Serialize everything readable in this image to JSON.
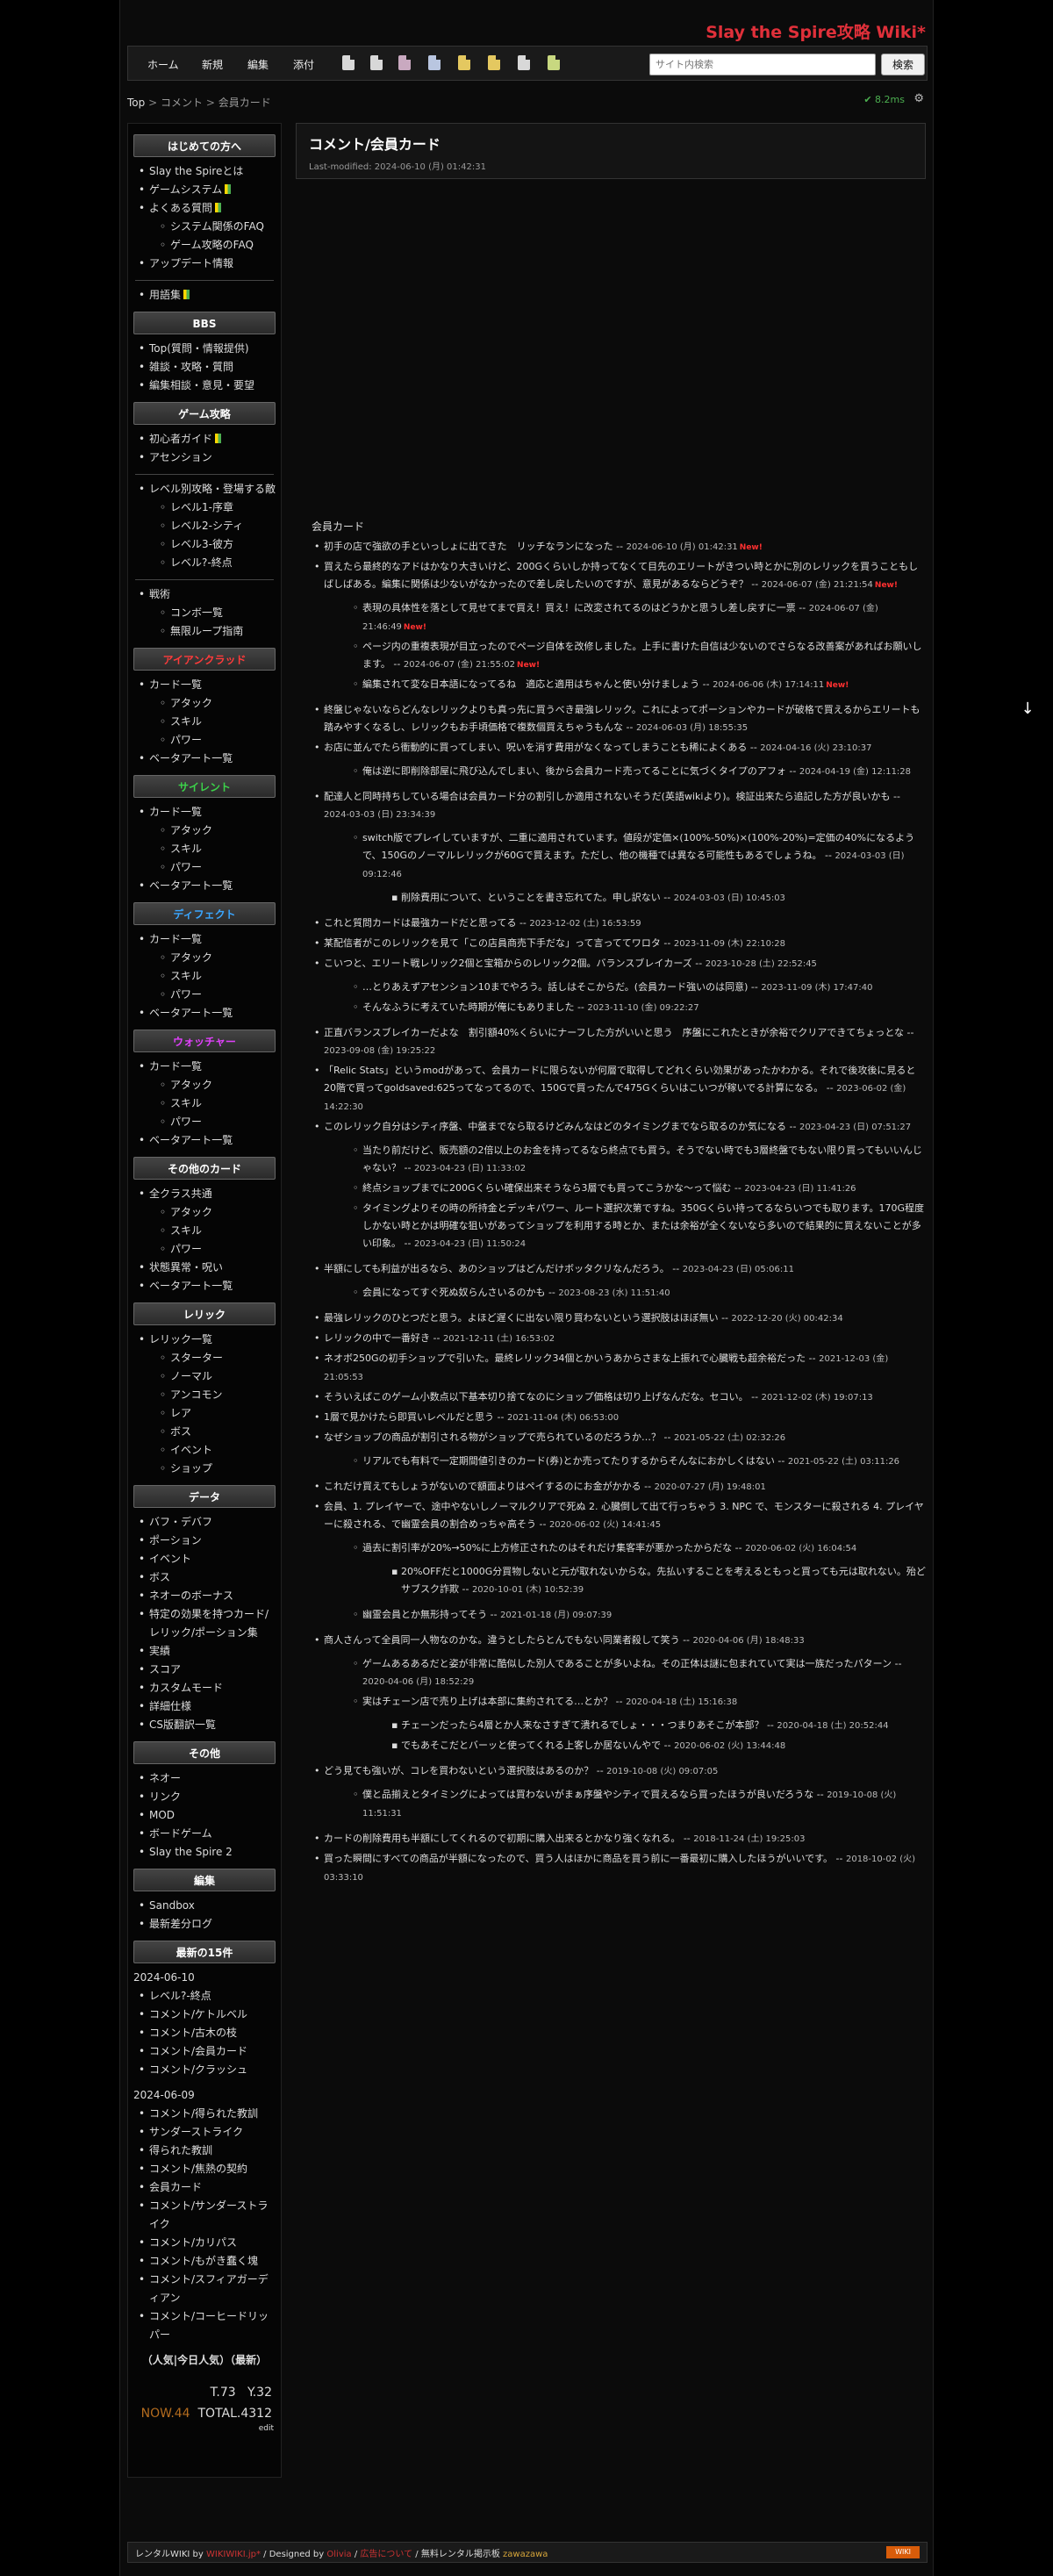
{
  "site_title": "Slay the Spire攻略 Wiki*",
  "nav": {
    "links": [
      "ホーム",
      "新規",
      "編集",
      "添付"
    ],
    "search_placeholder": "サイト内検索",
    "search_button": "検索"
  },
  "breadcrumb": {
    "top": "Top",
    "sep": ">",
    "parent": "コメント",
    "current": "会員カード"
  },
  "timing": "8.2ms",
  "page": {
    "title": "コメント/会員カード",
    "last_modified": "Last-modified: 2024-06-10 (月) 01:42:31"
  },
  "sidebar": {
    "sections": [
      {
        "title": "はじめての方へ",
        "color": "white",
        "items": [
          {
            "label": "Slay the Spireとは",
            "level": 0
          },
          {
            "label": "ゲームシステム",
            "level": 0,
            "leaf": true
          },
          {
            "label": "よくある質問",
            "level": 0,
            "leaf": true
          },
          {
            "label": "システム関係のFAQ",
            "level": 1
          },
          {
            "label": "ゲーム攻略のFAQ",
            "level": 1
          },
          {
            "label": "アップデート情報",
            "level": 0
          },
          {
            "label": "---"
          },
          {
            "label": "用語集",
            "level": 0,
            "leaf": true
          }
        ]
      },
      {
        "title": "BBS",
        "color": "white",
        "items": [
          {
            "label": "Top(質問・情報提供)",
            "level": 0
          },
          {
            "label": "雑談・攻略・質問",
            "level": 0
          },
          {
            "label": "編集相談・意見・要望",
            "level": 0
          }
        ]
      },
      {
        "title": "ゲーム攻略",
        "color": "white",
        "items": [
          {
            "label": "初心者ガイド",
            "level": 0,
            "leaf": true
          },
          {
            "label": "アセンション",
            "level": 0
          },
          {
            "label": "---"
          },
          {
            "label": "レベル別攻略・登場する敵",
            "level": 0
          },
          {
            "label": "レベル1-序章",
            "level": 1
          },
          {
            "label": "レベル2-シティ",
            "level": 1
          },
          {
            "label": "レベル3-彼方",
            "level": 1
          },
          {
            "label": "レベル?-終点",
            "level": 1
          },
          {
            "label": "---"
          },
          {
            "label": "戦術",
            "level": 0
          },
          {
            "label": "コンボ一覧",
            "level": 1
          },
          {
            "label": "無限ループ指南",
            "level": 1
          }
        ]
      },
      {
        "title": "アイアンクラッド",
        "color": "red",
        "items": [
          {
            "label": "カード一覧",
            "level": 0
          },
          {
            "label": "アタック",
            "level": 1
          },
          {
            "label": "スキル",
            "level": 1
          },
          {
            "label": "パワー",
            "level": 1
          },
          {
            "label": "ベータアート一覧",
            "level": 0
          }
        ]
      },
      {
        "title": "サイレント",
        "color": "green",
        "items": [
          {
            "label": "カード一覧",
            "level": 0
          },
          {
            "label": "アタック",
            "level": 1
          },
          {
            "label": "スキル",
            "level": 1
          },
          {
            "label": "パワー",
            "level": 1
          },
          {
            "label": "ベータアート一覧",
            "level": 0
          }
        ]
      },
      {
        "title": "ディフェクト",
        "color": "blue",
        "items": [
          {
            "label": "カード一覧",
            "level": 0
          },
          {
            "label": "アタック",
            "level": 1
          },
          {
            "label": "スキル",
            "level": 1
          },
          {
            "label": "パワー",
            "level": 1
          },
          {
            "label": "ベータアート一覧",
            "level": 0
          }
        ]
      },
      {
        "title": "ウォッチャー",
        "color": "purple",
        "items": [
          {
            "label": "カード一覧",
            "level": 0
          },
          {
            "label": "アタック",
            "level": 1
          },
          {
            "label": "スキル",
            "level": 1
          },
          {
            "label": "パワー",
            "level": 1
          },
          {
            "label": "ベータアート一覧",
            "level": 0
          }
        ]
      },
      {
        "title": "その他のカード",
        "color": "white",
        "items": [
          {
            "label": "全クラス共通",
            "level": 0
          },
          {
            "label": "アタック",
            "level": 1
          },
          {
            "label": "スキル",
            "level": 1
          },
          {
            "label": "パワー",
            "level": 1
          },
          {
            "label": "状態異常・呪い",
            "level": 0
          },
          {
            "label": "ベータアート一覧",
            "level": 0
          }
        ]
      },
      {
        "title": "レリック",
        "color": "white",
        "items": [
          {
            "label": "レリック一覧",
            "level": 0
          },
          {
            "label": "スターター",
            "level": 1
          },
          {
            "label": "ノーマル",
            "level": 1
          },
          {
            "label": "アンコモン",
            "level": 1
          },
          {
            "label": "レア",
            "level": 1
          },
          {
            "label": "ボス",
            "level": 1
          },
          {
            "label": "イベント",
            "level": 1
          },
          {
            "label": "ショップ",
            "level": 1
          }
        ]
      },
      {
        "title": "データ",
        "color": "white",
        "items": [
          {
            "label": "バフ・デバフ",
            "level": 0
          },
          {
            "label": "ポーション",
            "level": 0
          },
          {
            "label": "イベント",
            "level": 0
          },
          {
            "label": "ボス",
            "level": 0
          },
          {
            "label": "ネオーのボーナス",
            "level": 0
          },
          {
            "label": "特定の効果を持つカード/レリック/ポーション集",
            "level": 0
          },
          {
            "label": "実績",
            "level": 0
          },
          {
            "label": "スコア",
            "level": 0
          },
          {
            "label": "カスタムモード",
            "level": 0
          },
          {
            "label": "詳細仕様",
            "level": 0
          },
          {
            "label": "CS版翻訳一覧",
            "level": 0
          }
        ]
      },
      {
        "title": "その他",
        "color": "white",
        "items": [
          {
            "label": "ネオー",
            "level": 0
          },
          {
            "label": "リンク",
            "level": 0
          },
          {
            "label": "MOD",
            "level": 0
          },
          {
            "label": "ボードゲーム",
            "level": 0
          },
          {
            "label": "Slay the Spire 2",
            "level": 0
          }
        ]
      },
      {
        "title": "編集",
        "color": "white",
        "items": [
          {
            "label": "Sandbox",
            "level": 0
          },
          {
            "label": "最新差分ログ",
            "level": 0
          }
        ]
      }
    ],
    "recent": {
      "title": "最新の15件",
      "groups": [
        {
          "date": "2024-06-10",
          "items": [
            "レベル?-終点",
            "コメント/ケトルベル",
            "コメント/古木の枝",
            "コメント/会員カード",
            "コメント/クラッシュ"
          ]
        },
        {
          "date": "2024-06-09",
          "items": [
            "コメント/得られた教訓",
            "サンダーストライク",
            "得られた教訓",
            "コメント/焦熱の契約",
            "会員カード",
            "コメント/サンダーストライク",
            "コメント/カリパス",
            "コメント/もがき蠢く塊",
            "コメント/スフィアガーディアン",
            "コメント/コーヒードリッパー"
          ]
        }
      ]
    },
    "popular": "（人気|今日人気）（最新）",
    "counter": {
      "today": "T.73",
      "yesterday": "Y.32",
      "now": "NOW.44",
      "total": "TOTAL.4312"
    },
    "edit": "edit"
  },
  "comments_section_label": "会員カード",
  "comments": [
    {
      "text": "初手の店で強欲の手といっしょに出てきた　リッチなランになった",
      "date": "2024-06-10 (月) 01:42:31",
      "new": true
    },
    {
      "text": "買えたら最終的なアドはかなり大きいけど、200Gくらいしか持ってなくて目先のエリートがきつい時とかに別のレリックを買うこともしばしばある。編集に関係は少ないがなかったので差し戻したいのですが、意見があるならどうぞ？",
      "date": "2024-06-07 (金) 21:21:54",
      "new": true,
      "replies": [
        {
          "text": "表現の具体性を落として見せてまで買え！買え！に改変されてるのはどうかと思うし差し戻すに一票",
          "date": "2024-06-07 (金) 21:46:49",
          "new": true
        },
        {
          "text": "ページ内の重複表現が目立ったのでページ自体を改修しました。上手に書けた自信は少ないのでさらなる改善案があればお願いします。",
          "date": "2024-06-07 (金) 21:55:02",
          "new": true
        },
        {
          "text": "編集されて変な日本語になってるね　適応と適用はちゃんと使い分けましょう",
          "date": "2024-06-06 (木) 17:14:11",
          "new": true
        }
      ]
    },
    {
      "text": "終盤じゃないならどんなレリックよりも真っ先に買うべき最強レリック。これによってポーションやカードが破格で買えるからエリートも踏みやすくなるし、レリックもお手頃価格で複数個買えちゃうもんな",
      "date": "2024-06-03 (月) 18:55:35"
    },
    {
      "text": "お店に並んでたら衝動的に買ってしまい、呪いを消す費用がなくなってしまうことも稀によくある",
      "date": "2024-04-16 (火) 23:10:37",
      "replies": [
        {
          "text": "俺は逆に即削除部屋に飛び込んでしまい、後から会員カード売ってることに気づくタイプのアフォ",
          "date": "2024-04-19 (金) 12:11:28"
        }
      ]
    },
    {
      "text": "配達人と同時持ちしている場合は会員カード分の割引しか適用されないそうだ(英語wikiより)。検証出来たら追記した方が良いかも",
      "date": "2024-03-03 (日) 23:34:39",
      "replies": [
        {
          "text": "switch版でプレイしていますが、二重に適用されています。値段が定価×(100%-50%)×(100%-20%)=定価の40%になるようで、150Gのノーマルレリックが60Gで買えます。ただし、他の機種では異なる可能性もあるでしょうね。",
          "date": "2024-03-03 (日) 09:12:46",
          "replies": [
            {
              "text": "削除費用について、ということを書き忘れてた。申し訳ない",
              "date": "2024-03-03 (日) 10:45:03"
            }
          ]
        }
      ]
    },
    {
      "text": "これと質問カードは最強カードだと思ってる",
      "date": "2023-12-02 (土) 16:53:59"
    },
    {
      "text": "某配信者がこのレリックを見て「この店員商売下手だな」って言っててワロタ",
      "date": "2023-11-09 (木) 22:10:28"
    },
    {
      "text": "こいつと、エリート戦レリック2個と宝箱からのレリック2個。バランスブレイカーズ",
      "date": "2023-10-28 (土) 22:52:45",
      "replies": [
        {
          "text": "…とりあえずアセンション10までやろう。話しはそこからだ。(会員カード強いのは同意)",
          "date": "2023-11-09 (木) 17:47:40"
        },
        {
          "text": "そんなふうに考えていた時期が俺にもありました",
          "date": "2023-11-10 (金) 09:22:27"
        }
      ]
    },
    {
      "text": "正直バランスブレイカーだよな　割引額40%くらいにナーフした方がいいと思う　序盤にこれたときが余裕でクリアできてちょっとな",
      "date": "2023-09-08 (金) 19:25:22"
    },
    {
      "text": "「Relic Stats」というmodがあって、会員カードに限らないが何層で取得してどれくらい効果があったかわかる。それで後攻後に見ると20階で買ってgoldsaved:625ってなってるので、150Gで買ったんで475Gくらいはこいつが稼いでる計算になる。",
      "date": "2023-06-02 (金) 14:22:30"
    },
    {
      "text": "このレリック自分はシティ序盤、中盤までなら取るけどみんなはどのタイミングまでなら取るのか気になる",
      "date": "2023-04-23 (日) 07:51:27",
      "replies": [
        {
          "text": "当たり前だけど、販売額の2倍以上のお金を持ってるなら終点でも買う。そうでない時でも3層終盤でもない限り買ってもいいんじゃない？",
          "date": "2023-04-23 (日) 11:33:02"
        },
        {
          "text": "終点ショップまでに200Gくらい確保出来そうなら3層でも買ってこうかな～って悩む",
          "date": "2023-04-23 (日) 11:41:26"
        },
        {
          "text": "タイミングよりその時の所持金とデッキパワー、ルート選択次第ですね。350Gくらい持ってるならいつでも取ります。170G程度しかない時とかは明確な狙いがあってショップを利用する時とか、または余裕が全くないなら多いので結果的に買えないことが多い印象。",
          "date": "2023-04-23 (日) 11:50:24"
        }
      ]
    },
    {
      "text": "半額にしても利益が出るなら、あのショップはどんだけボッタクリなんだろう。",
      "date": "2023-04-23 (日) 05:06:11",
      "replies": [
        {
          "text": "会員になってすぐ死ぬ奴らんさいるのかも",
          "date": "2023-08-23 (水) 11:51:40"
        }
      ]
    },
    {
      "text": "最強レリックのひとつだと思う。よほど遅くに出ない限り買わないという選択肢はほぼ無い",
      "date": "2022-12-20 (火) 00:42:34"
    },
    {
      "text": "レリックの中で一番好き",
      "date": "2021-12-11 (土) 16:53:02"
    },
    {
      "text": "ネオボ250Gの初手ショップで引いた。最終レリック34個とかいうあからさまな上振れで心臓戦も超余裕だった",
      "date": "2021-12-03 (金) 21:05:53"
    },
    {
      "text": "そういえばこのゲーム小数点以下基本切り捨てなのにショップ価格は切り上げなんだな。セコい。",
      "date": "2021-12-02 (木) 19:07:13"
    },
    {
      "text": "1層で見かけたら即買いレベルだと思う",
      "date": "2021-11-04 (木) 06:53:00"
    },
    {
      "text": "なぜショップの商品が割引される物がショップで売られているのだろうか…？",
      "date": "2021-05-22 (土) 02:32:26",
      "replies": [
        {
          "text": "リアルでも有料で一定期間値引きのカード(券)とか売ってたりするからそんなにおかしくはない",
          "date": "2021-05-22 (土) 03:11:26"
        }
      ]
    },
    {
      "text": "これだけ買えてもしょうがないので額面よりはペイするのにお金がかかる",
      "date": "2020-07-27 (月) 19:48:01"
    },
    {
      "text": "会員、1. プレイヤーで、途中やないしノーマルクリアで死ぬ 2. 心臓倒して出て行っちゃう 3. NPC で、モンスターに殺される 4. プレイヤーに殺される、で幽霊会員の割合めっちゃ高そう",
      "date": "2020-06-02 (火) 14:41:45",
      "replies": [
        {
          "text": "過去に割引率が20%→50%に上方修正されたのはそれだけ集客率が悪かったからだな",
          "date": "2020-06-02 (火) 16:04:54",
          "replies": [
            {
              "text": "20%OFFだと1000G分買物しないと元が取れないからな。先払いすることを考えるともっと買っても元は取れない。殆どサブスク詐欺",
              "date": "2020-10-01 (木) 10:52:39"
            }
          ]
        },
        {
          "text": "幽霊会員とか無形持ってそう",
          "date": "2021-01-18 (月) 09:07:39"
        }
      ]
    },
    {
      "text": "商人さんって全員同一人物なのかな。違うとしたらとんでもない同業者殺して笑う",
      "date": "2020-04-06 (月) 18:48:33",
      "replies": [
        {
          "text": "ゲームあるあるだと姿が非常に酷似した別人であることが多いよね。その正体は謎に包まれていて実は一族だったパターン",
          "date": "2020-04-06 (月) 18:52:29"
        },
        {
          "text": "実はチェーン店で売り上げは本部に集約されてる…とか？",
          "date": "2020-04-18 (土) 15:16:38",
          "replies": [
            {
              "text": "チェーンだったら4層とか人来なさすぎて潰れるでしょ・・・つまりあそこが本部？",
              "date": "2020-04-18 (土) 20:52:44"
            },
            {
              "text": "でもあそこだとバーッと使ってくれる上客しか居ないんやで",
              "date": "2020-06-02 (火) 13:44:48"
            }
          ]
        }
      ]
    },
    {
      "text": "どう見ても強いが、コレを買わないという選択肢はあるのか？",
      "date": "2019-10-08 (火) 09:07:05",
      "replies": [
        {
          "text": "僕と品揃えとタイミングによっては買わないがまぁ序盤やシティで買えるなら買ったほうが良いだろうな",
          "date": "2019-10-08 (火) 11:51:31"
        }
      ]
    },
    {
      "text": "カードの削除費用も半額にしてくれるので初期に購入出来るとかなり強くなれる。",
      "date": "2018-11-24 (土) 19:25:03"
    },
    {
      "text": "買った瞬間にすべての商品が半額になったので、買う人はほかに商品を買う前に一番最初に購入したほうがいいです。",
      "date": "2018-10-02 (火) 03:33:10"
    }
  ],
  "footer": {
    "prefix": "レンタルWIKI by",
    "wikiwiki": "WIKIWIKI.jp*",
    "designed": "/ Designed by",
    "olivia": "Olivia",
    "sep": "/",
    "ad": "広告について",
    "free": "/ 無料レンタル掲示板",
    "zawazawa": "zawazawa",
    "badge": "WIKI"
  }
}
